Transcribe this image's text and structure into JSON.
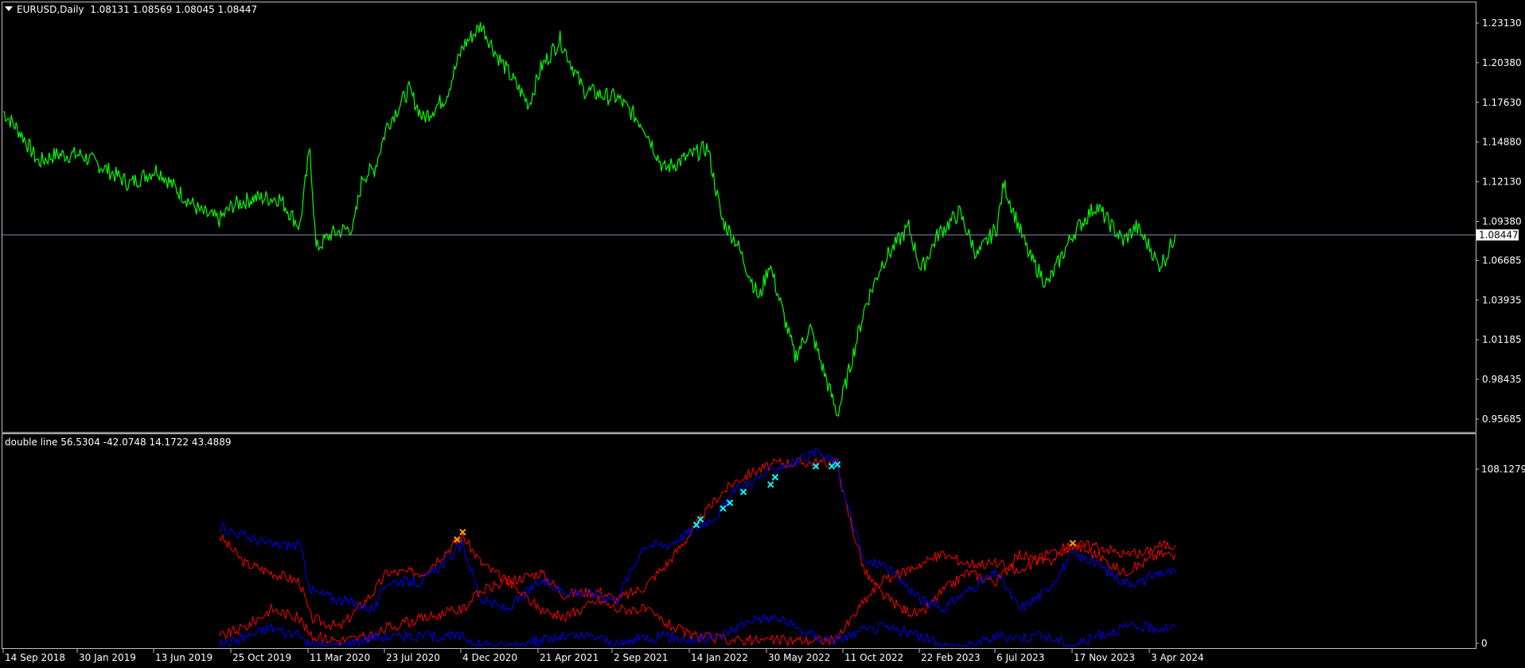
{
  "main_chart": {
    "symbol": "EURUSD",
    "timeframe": "Daily",
    "ohlc": [
      "1.08131",
      "1.08569",
      "1.08045",
      "1.08447"
    ],
    "price_axis_labels": [
      "1.23130",
      "1.20380",
      "1.17630",
      "1.14880",
      "1.12130",
      "1.09380",
      "1.06685",
      "1.03935",
      "1.01185",
      "0.98435",
      "0.95685"
    ],
    "current_price_label": "1.08447"
  },
  "indicator": {
    "name": "double line",
    "values": [
      "56.5304",
      "-42.0748",
      "14.1722",
      "43.4889"
    ],
    "axis_max_label": "108.1279",
    "axis_min_label": "0"
  },
  "time_axis_labels": [
    "14 Sep 2018",
    "30 Jan 2019",
    "13 Jun 2019",
    "25 Oct 2019",
    "11 Mar 2020",
    "23 Jul 2020",
    "4 Dec 2020",
    "21 Apr 2021",
    "2 Sep 2021",
    "14 Jan 2022",
    "30 May 2022",
    "11 Oct 2022",
    "22 Feb 2023",
    "6 Jul 2023",
    "17 Nov 2023",
    "3 Apr 2024"
  ],
  "colors": {
    "background": "#000000",
    "price_line": "#00ff00",
    "bid_line": "#7b8ea8",
    "border": "#c0c0c0",
    "ind_red": "#ff0000",
    "ind_blue": "#0000ff",
    "marker_cyan": "#00ffff",
    "marker_orange": "#ffa500"
  },
  "chart_data": [
    {
      "type": "line",
      "title": "EURUSD,Daily",
      "series": [
        {
          "name": "EURUSD",
          "x": [
            "2018-09-14",
            "2018-10-15",
            "2018-11-15",
            "2018-12-15",
            "2019-01-30",
            "2019-03-15",
            "2019-04-25",
            "2019-06-13",
            "2019-07-20",
            "2019-08-30",
            "2019-10-01",
            "2019-10-25",
            "2019-12-01",
            "2020-01-15",
            "2020-02-20",
            "2020-03-09",
            "2020-03-20",
            "2020-04-15",
            "2020-05-25",
            "2020-06-10",
            "2020-07-01",
            "2020-07-23",
            "2020-08-31",
            "2020-09-25",
            "2020-11-04",
            "2020-12-04",
            "2021-01-06",
            "2021-02-01",
            "2021-03-31",
            "2021-04-21",
            "2021-05-25",
            "2021-07-05",
            "2021-08-20",
            "2021-09-02",
            "2021-10-20",
            "2021-11-24",
            "2022-01-14",
            "2022-02-10",
            "2022-03-07",
            "2022-04-01",
            "2022-05-12",
            "2022-05-30",
            "2022-07-14",
            "2022-08-10",
            "2022-09-27",
            "2022-10-11",
            "2022-11-15",
            "2022-12-15",
            "2023-01-31",
            "2023-02-22",
            "2023-03-24",
            "2023-05-01",
            "2023-06-01",
            "2023-07-06",
            "2023-07-18",
            "2023-09-01",
            "2023-10-03",
            "2023-11-17",
            "2023-12-28",
            "2024-02-14",
            "2024-03-08",
            "2024-04-03",
            "2024-04-16",
            "2024-05-01",
            "2024-05-16"
          ],
          "y": [
            1.17,
            1.155,
            1.135,
            1.14,
            1.14,
            1.13,
            1.12,
            1.13,
            1.115,
            1.1,
            1.095,
            1.105,
            1.11,
            1.11,
            1.09,
            1.145,
            1.075,
            1.085,
            1.09,
            1.125,
            1.13,
            1.16,
            1.185,
            1.165,
            1.18,
            1.215,
            1.23,
            1.21,
            1.175,
            1.2,
            1.22,
            1.185,
            1.18,
            1.18,
            1.16,
            1.13,
            1.14,
            1.145,
            1.095,
            1.08,
            1.04,
            1.065,
            1.0,
            1.02,
            0.96,
            0.98,
            1.035,
            1.065,
            1.09,
            1.06,
            1.085,
            1.1,
            1.07,
            1.09,
            1.12,
            1.07,
            1.05,
            1.085,
            1.105,
            1.08,
            1.09,
            1.075,
            1.063,
            1.07,
            1.085
          ]
        }
      ],
      "current_price": 1.08447,
      "ylim": [
        0.9486,
        1.2445
      ],
      "y_ticks": [
        1.2313,
        1.2038,
        1.1763,
        1.1488,
        1.1213,
        1.0938,
        1.06685,
        1.03935,
        1.01185,
        0.98435,
        0.95685
      ]
    },
    {
      "type": "line",
      "title": "double line 56.5304 -42.0748 14.1722 43.4889",
      "x": [
        "2019-10-01",
        "2019-11-15",
        "2020-01-01",
        "2020-02-20",
        "2020-03-11",
        "2020-05-01",
        "2020-07-01",
        "2020-07-23",
        "2020-09-25",
        "2020-12-04",
        "2021-01-06",
        "2021-02-20",
        "2021-04-21",
        "2021-06-01",
        "2021-08-01",
        "2021-09-02",
        "2021-10-20",
        "2021-12-01",
        "2022-01-14",
        "2022-03-01",
        "2022-04-01",
        "2022-05-01",
        "2022-06-15",
        "2022-07-15",
        "2022-08-20",
        "2022-09-27",
        "2022-10-11",
        "2022-11-15",
        "2022-12-15",
        "2023-01-20",
        "2023-02-22",
        "2023-04-01",
        "2023-05-15",
        "2023-07-06",
        "2023-08-15",
        "2023-10-01",
        "2023-11-17",
        "2023-12-28",
        "2024-02-14",
        "2024-03-20",
        "2024-04-16",
        "2024-05-16"
      ],
      "series": [
        {
          "name": "",
          "color": "red",
          "values": [
            60,
            45,
            40,
            35,
            15,
            10,
            30,
            40,
            40,
            60,
            45,
            35,
            40,
            28,
            30,
            25,
            32,
            45,
            63,
            82,
            90,
            95,
            100,
            100,
            100,
            100,
            78,
            40,
            28,
            20,
            17,
            30,
            40,
            35,
            50,
            45,
            55,
            50,
            40,
            45,
            50,
            50
          ]
        },
        {
          "name": "",
          "color": "blue",
          "values": [
            65,
            60,
            55,
            55,
            30,
            25,
            20,
            35,
            35,
            55,
            25,
            20,
            35,
            30,
            28,
            25,
            55,
            55,
            63,
            72,
            85,
            90,
            98,
            100,
            105,
            100,
            80,
            45,
            45,
            35,
            25,
            20,
            30,
            40,
            20,
            30,
            50,
            45,
            35,
            35,
            40,
            40
          ]
        },
        {
          "name": "",
          "color": "red",
          "values": [
            5,
            10,
            20,
            15,
            5,
            3,
            5,
            10,
            15,
            20,
            30,
            35,
            20,
            15,
            25,
            20,
            20,
            12,
            5,
            4,
            3,
            3,
            3,
            3,
            3,
            3,
            10,
            25,
            35,
            40,
            45,
            50,
            45,
            45,
            40,
            50,
            55,
            55,
            50,
            50,
            55,
            55
          ]
        },
        {
          "name": "",
          "color": "blue",
          "values": [
            0,
            5,
            10,
            5,
            0,
            0,
            5,
            5,
            5,
            5,
            0,
            0,
            3,
            5,
            5,
            0,
            5,
            5,
            3,
            5,
            10,
            15,
            15,
            10,
            5,
            3,
            5,
            8,
            10,
            8,
            5,
            0,
            0,
            5,
            5,
            5,
            0,
            5,
            10,
            10,
            10,
            10
          ]
        }
      ],
      "markers": [
        {
          "x": "2020-11-24",
          "y": 58,
          "color": "orange"
        },
        {
          "x": "2020-12-04",
          "y": 62,
          "color": "orange"
        },
        {
          "x": "2022-01-21",
          "y": 66,
          "color": "cyan"
        },
        {
          "x": "2022-01-28",
          "y": 69,
          "color": "cyan"
        },
        {
          "x": "2022-03-09",
          "y": 75,
          "color": "cyan"
        },
        {
          "x": "2022-03-21",
          "y": 78,
          "color": "cyan"
        },
        {
          "x": "2022-04-14",
          "y": 84,
          "color": "cyan"
        },
        {
          "x": "2022-06-01",
          "y": 88,
          "color": "cyan"
        },
        {
          "x": "2022-06-09",
          "y": 92,
          "color": "cyan"
        },
        {
          "x": "2022-08-20",
          "y": 98,
          "color": "cyan"
        },
        {
          "x": "2022-09-17",
          "y": 98,
          "color": "cyan"
        },
        {
          "x": "2022-09-27",
          "y": 99,
          "color": "cyan"
        },
        {
          "x": "2023-11-17",
          "y": 56,
          "color": "orange"
        }
      ],
      "ylim": [
        0,
        108.1279
      ]
    }
  ]
}
